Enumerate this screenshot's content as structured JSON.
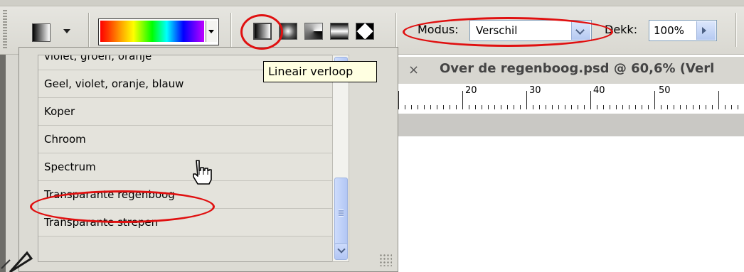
{
  "toolbar": {
    "mode_label": "Modus:",
    "mode_value": "Verschil",
    "opacity_label": "Dekk:",
    "opacity_value": "100%",
    "gradient_types": [
      {
        "name": "linear-gradient-icon"
      },
      {
        "name": "radial-gradient-icon"
      },
      {
        "name": "angle-gradient-icon"
      },
      {
        "name": "reflected-gradient-icon"
      },
      {
        "name": "diamond-gradient-icon"
      }
    ]
  },
  "tooltip": {
    "text": "Lineair verloop"
  },
  "document": {
    "close_glyph": "×",
    "title": "Over de regenboog.psd @ 60,6% (Verl",
    "ruler_labels": [
      "20",
      "30",
      "40",
      "50"
    ]
  },
  "gradient_presets": {
    "items": [
      "violet, groen, oranje",
      "Geel, violet, oranje, blauw",
      "Koper",
      "Chroom",
      "Spectrum",
      "Transparante regenboog",
      "Transparante strepen"
    ],
    "selected": "Transparante regenboog"
  },
  "annotation_color": "#e01010"
}
